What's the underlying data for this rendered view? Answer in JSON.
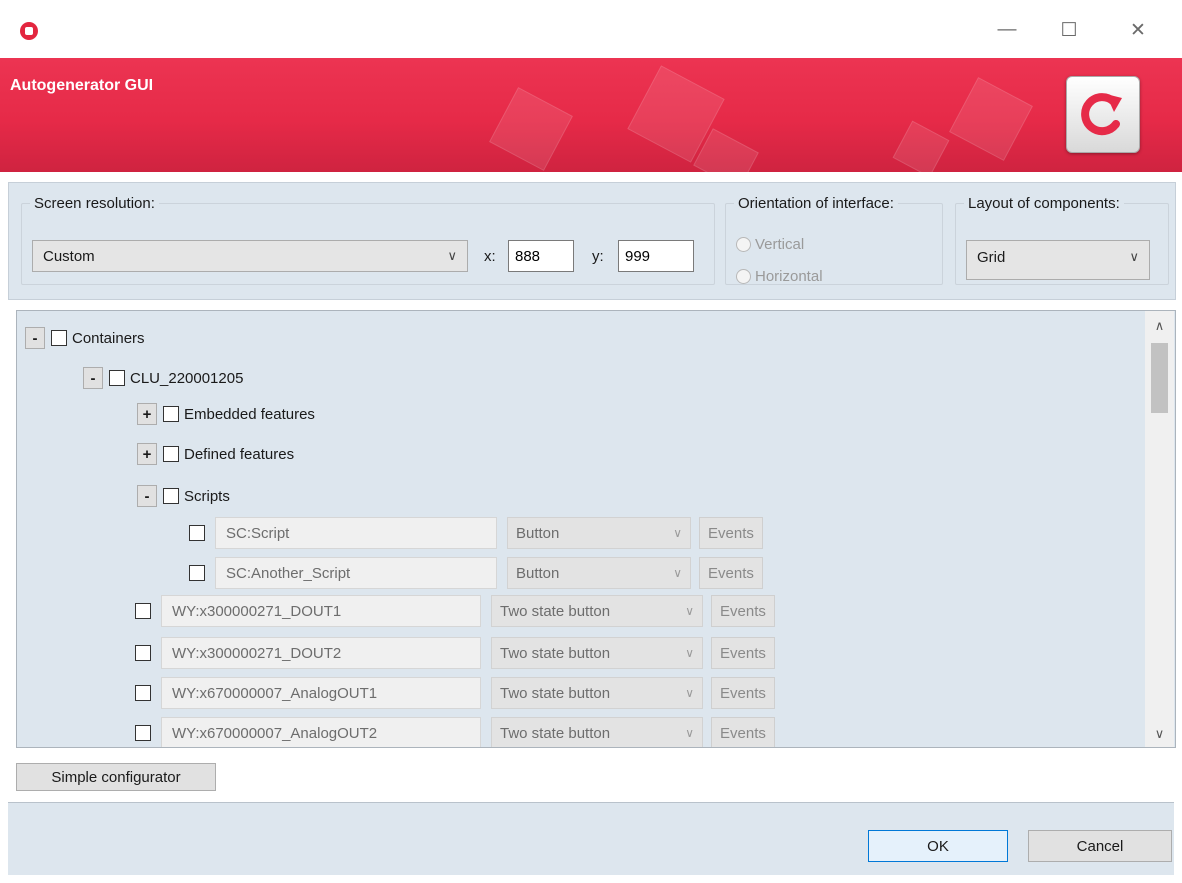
{
  "window": {
    "minimize_icon": "minimize-icon",
    "maximize_icon": "maximize-icon",
    "close_icon": "close-icon",
    "minimize_glyph": "—",
    "maximize_glyph": "☐",
    "close_glyph": "✕"
  },
  "header": {
    "title": "Autogenerator GUI",
    "refresh_icon": "refresh-icon",
    "accent_color": "#e62a48"
  },
  "settings": {
    "resolution": {
      "legend": "Screen resolution:",
      "selected": "Custom",
      "x_label": "x:",
      "x_value": "888",
      "y_label": "y:",
      "y_value": "999"
    },
    "orientation": {
      "legend": "Orientation of interface:",
      "options": [
        "Vertical",
        "Horizontal"
      ]
    },
    "layout": {
      "legend": "Layout of components:",
      "selected": "Grid"
    }
  },
  "tree": {
    "expanded_glyph": "-",
    "collapsed_glyph": "+",
    "containers_label": "Containers",
    "clu_label": "CLU_220001205",
    "embedded_label": "Embedded features",
    "defined_label": "Defined features",
    "scripts_label": "Scripts",
    "scripts": [
      {
        "name": "SC:Script",
        "type": "Button",
        "events": "Events"
      },
      {
        "name": "SC:Another_Script",
        "type": "Button",
        "events": "Events"
      }
    ],
    "outputs": [
      {
        "name": "WY:x300000271_DOUT1",
        "type": "Two state button",
        "events": "Events"
      },
      {
        "name": "WY:x300000271_DOUT2",
        "type": "Two state button",
        "events": "Events"
      },
      {
        "name": "WY:x670000007_AnalogOUT1",
        "type": "Two state button",
        "events": "Events"
      },
      {
        "name": "WY:x670000007_AnalogOUT2",
        "type": "Two state button",
        "events": "Events"
      }
    ]
  },
  "buttons": {
    "simple_configurator": "Simple configurator",
    "ok": "OK",
    "cancel": "Cancel"
  }
}
